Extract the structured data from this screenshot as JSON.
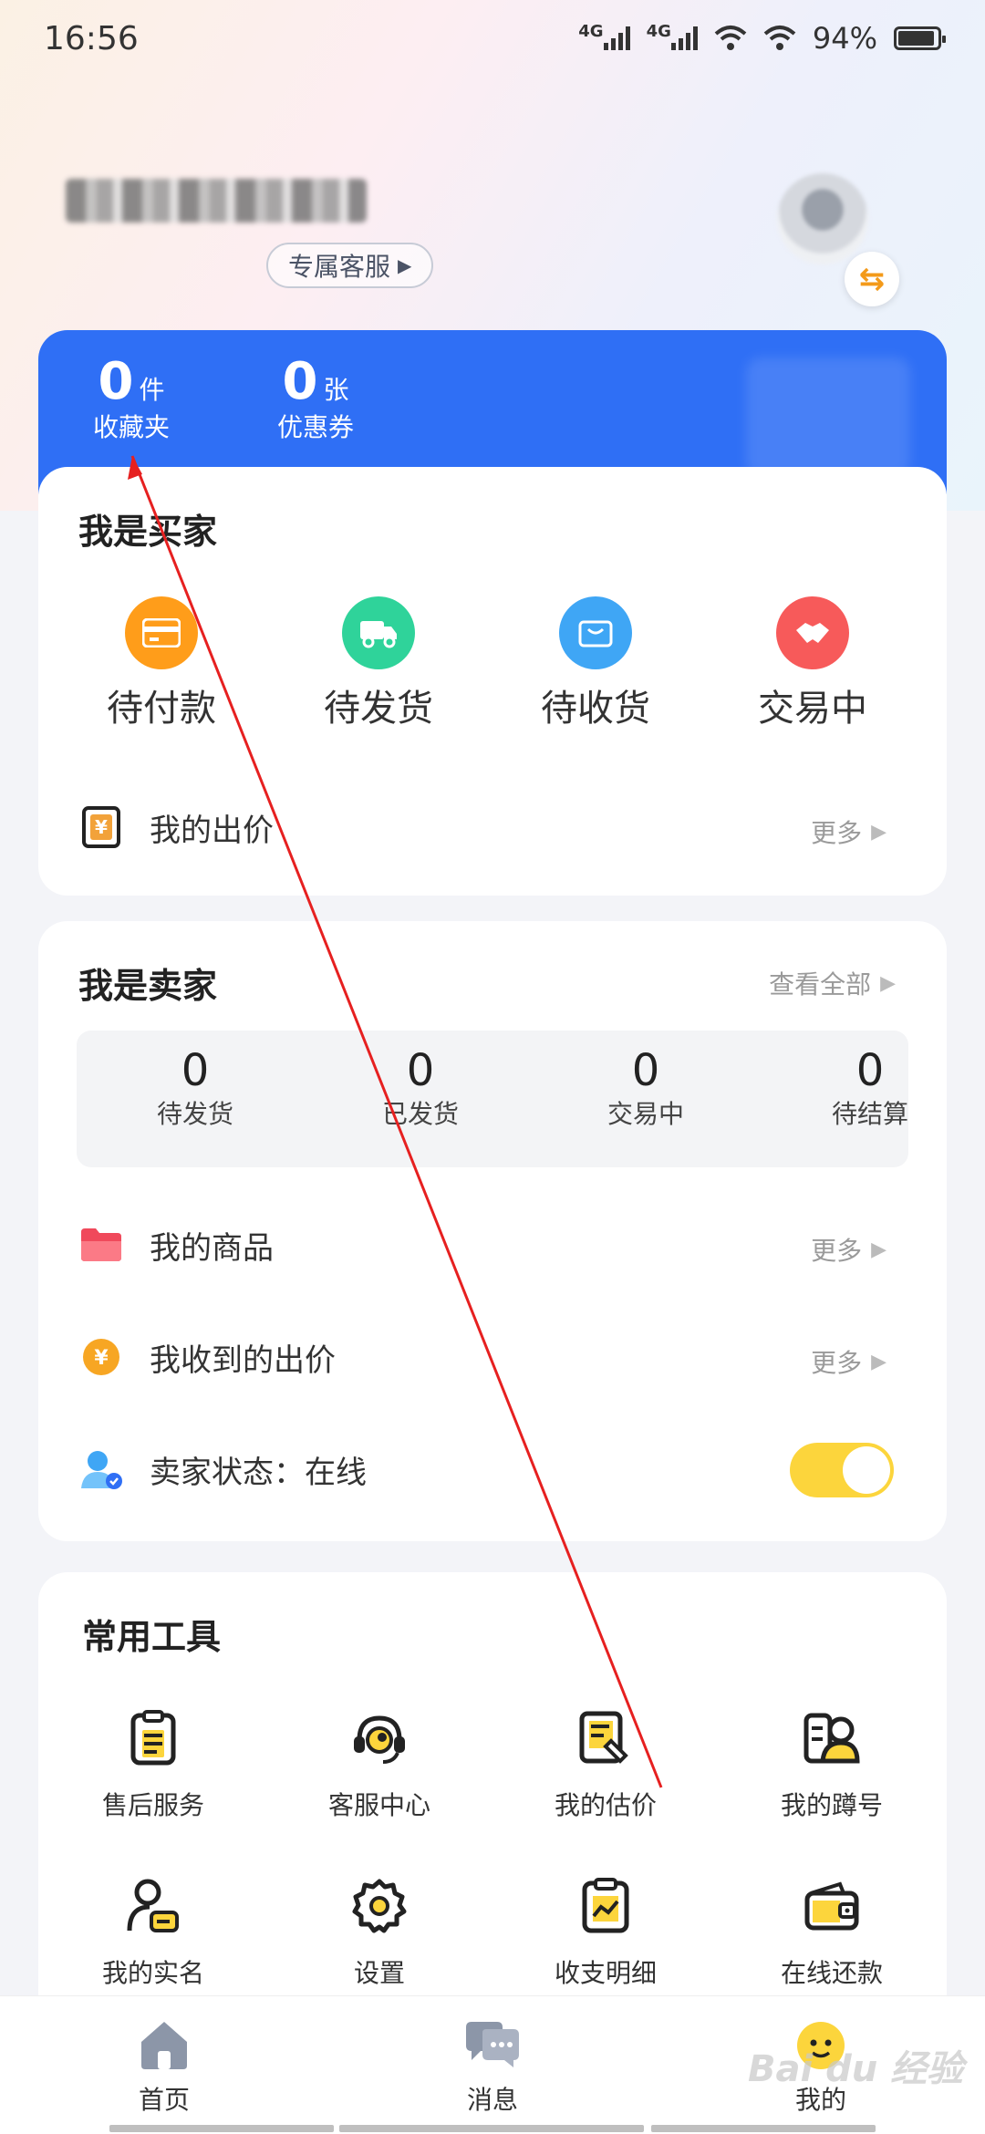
{
  "status_bar": {
    "time": "16:56",
    "network1": "4G",
    "network2": "4G",
    "battery": "94%",
    "battery_level": 0.94
  },
  "profile": {
    "service_button": "专属客服"
  },
  "summary": {
    "favorites": {
      "value": "0",
      "unit": "件",
      "label": "收藏夹"
    },
    "coupons": {
      "value": "0",
      "unit": "张",
      "label": "优惠券"
    }
  },
  "buyer": {
    "title": "我是买家",
    "orders": [
      {
        "label": "待付款",
        "icon": "card-icon",
        "color": "#ff9d1a"
      },
      {
        "label": "待发货",
        "icon": "truck-icon",
        "color": "#2fd39a"
      },
      {
        "label": "待收货",
        "icon": "bag-icon",
        "color": "#3fa6f5"
      },
      {
        "label": "交易中",
        "icon": "handshake-icon",
        "color": "#f75a5a"
      }
    ],
    "my_bids": {
      "label": "我的出价",
      "more": "更多"
    }
  },
  "seller": {
    "title": "我是卖家",
    "view_all": "查看全部",
    "stats": [
      {
        "value": "0",
        "label": "待发货"
      },
      {
        "value": "0",
        "label": "已发货"
      },
      {
        "value": "0",
        "label": "交易中"
      },
      {
        "value": "0",
        "label": "待结算"
      }
    ],
    "my_products": {
      "label": "我的商品",
      "more": "更多"
    },
    "received_bids": {
      "label": "我收到的出价",
      "more": "更多"
    },
    "status": {
      "label": "卖家状态：在线",
      "on": true
    }
  },
  "tools": {
    "title": "常用工具",
    "items": [
      {
        "label": "售后服务",
        "icon": "clipboard-icon"
      },
      {
        "label": "客服中心",
        "icon": "headset-icon"
      },
      {
        "label": "我的估价",
        "icon": "appraisal-icon"
      },
      {
        "label": "我的蹲号",
        "icon": "watchlist-icon"
      },
      {
        "label": "我的实名",
        "icon": "id-icon"
      },
      {
        "label": "设置",
        "icon": "gear-icon"
      },
      {
        "label": "收支明细",
        "icon": "chart-clipboard-icon"
      },
      {
        "label": "在线还款",
        "icon": "wallet-icon"
      }
    ]
  },
  "tabbar": {
    "items": [
      {
        "label": "首页",
        "icon": "home-icon"
      },
      {
        "label": "消息",
        "icon": "message-icon"
      },
      {
        "label": "我的",
        "icon": "mine-icon"
      }
    ],
    "active_color": "#fcd53c"
  },
  "watermark": "Bai du 经验"
}
